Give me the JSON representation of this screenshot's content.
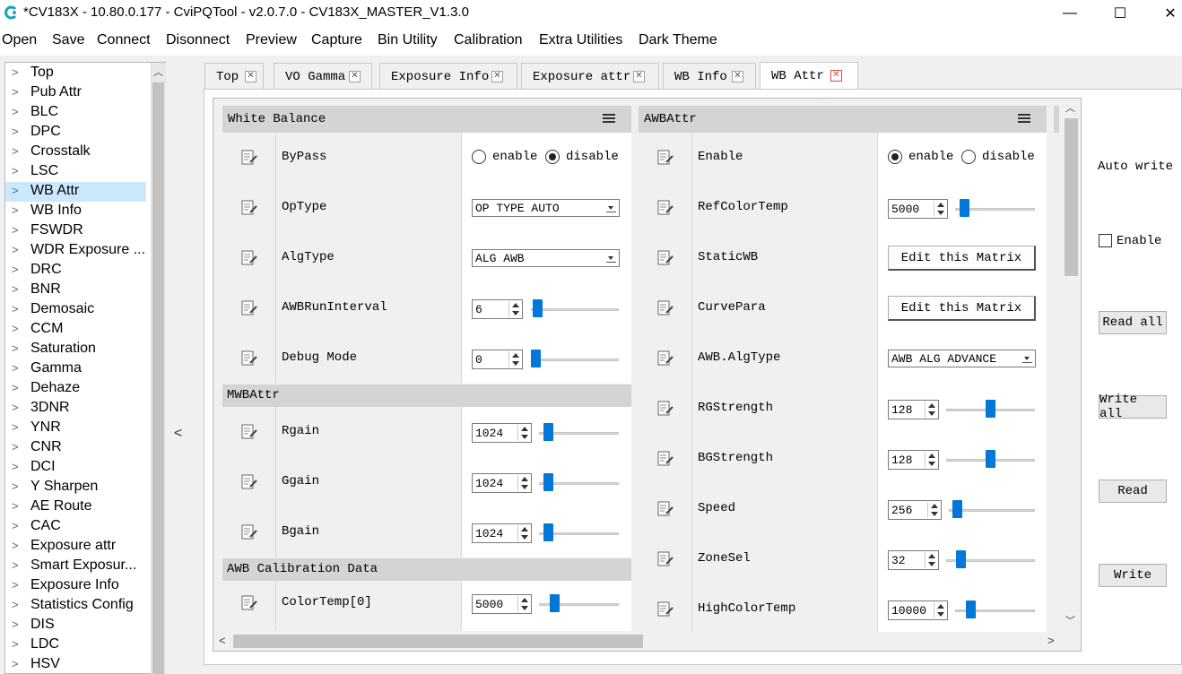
{
  "window": {
    "title": "*CV183X - 10.80.0.177 - CviPQTool - v2.0.7.0 - CV183X_MASTER_V1.3.0",
    "icon": "app-logo-icon",
    "minimize": "—",
    "maximize": "☐",
    "close": "✕"
  },
  "menu": [
    "Open",
    "Save",
    "Connect",
    "Disonnect",
    "Preview",
    "Capture",
    "Bin Utility",
    "Calibration",
    "Extra Utilities",
    "Dark Theme"
  ],
  "sidebar": {
    "items": [
      "Top",
      "Pub Attr",
      "BLC",
      "DPC",
      "Crosstalk",
      "LSC",
      "WB Attr",
      "WB Info",
      "FSWDR",
      "WDR Exposure ...",
      "DRC",
      "BNR",
      "Demosaic",
      "CCM",
      "Saturation",
      "Gamma",
      "Dehaze",
      "3DNR",
      "YNR",
      "CNR",
      "DCI",
      "Y Sharpen",
      "AE Route",
      "CAC",
      "Exposure attr",
      "Smart Exposur...",
      "Exposure Info",
      "Statistics Config",
      "DIS",
      "LDC",
      "HSV"
    ],
    "selected": "WB Attr"
  },
  "tabs": [
    "Top",
    "VO Gamma",
    "Exposure Info",
    "Exposure attr",
    "WB Info",
    "WB Attr"
  ],
  "active_tab": "WB Attr",
  "white_balance": {
    "title": "White Balance",
    "bypass": {
      "label": "ByPass",
      "opt1": "enable",
      "opt2": "disable",
      "selected": "disable"
    },
    "optype": {
      "label": "OpType",
      "value": "OP TYPE AUTO"
    },
    "algtype": {
      "label": "AlgType",
      "value": "ALG AWB"
    },
    "runinterval": {
      "label": "AWBRunInterval",
      "value": "6"
    },
    "debugmode": {
      "label": "Debug Mode",
      "value": "0"
    },
    "mwb_title": "MWBAttr",
    "rgain": {
      "label": "Rgain",
      "value": "1024"
    },
    "ggain": {
      "label": "Ggain",
      "value": "1024"
    },
    "bgain": {
      "label": "Bgain",
      "value": "1024"
    },
    "calib_title": "AWB Calibration Data",
    "colortemp0": {
      "label": "ColorTemp[0]",
      "value": "5000"
    }
  },
  "awb_attr": {
    "title": "AWBAttr",
    "enable": {
      "label": "Enable",
      "opt1": "enable",
      "opt2": "disable",
      "selected": "enable"
    },
    "refcolortemp": {
      "label": "RefColorTemp",
      "value": "5000"
    },
    "staticwb": {
      "label": "StaticWB",
      "button": "Edit this Matrix"
    },
    "curvepara": {
      "label": "CurvePara",
      "button": "Edit this Matrix"
    },
    "awbalgtype": {
      "label": "AWB.AlgType",
      "value": "AWB ALG ADVANCE"
    },
    "rgstrength": {
      "label": "RGStrength",
      "value": "128"
    },
    "bgstrength": {
      "label": "BGStrength",
      "value": "128"
    },
    "speed": {
      "label": "Speed",
      "value": "256"
    },
    "zonesel": {
      "label": "ZoneSel",
      "value": "32"
    },
    "highcolortemp": {
      "label": "HighColorTemp",
      "value": "10000"
    }
  },
  "right_panel": {
    "auto_write": "Auto write",
    "enable_label": "Enable",
    "read_all": "Read all",
    "write_all": "Write all",
    "read": "Read",
    "write": "Write"
  },
  "colors": {
    "accent": "#0078d7",
    "selected_bg": "#cce8ff",
    "header_bg": "#d4d4d4"
  }
}
